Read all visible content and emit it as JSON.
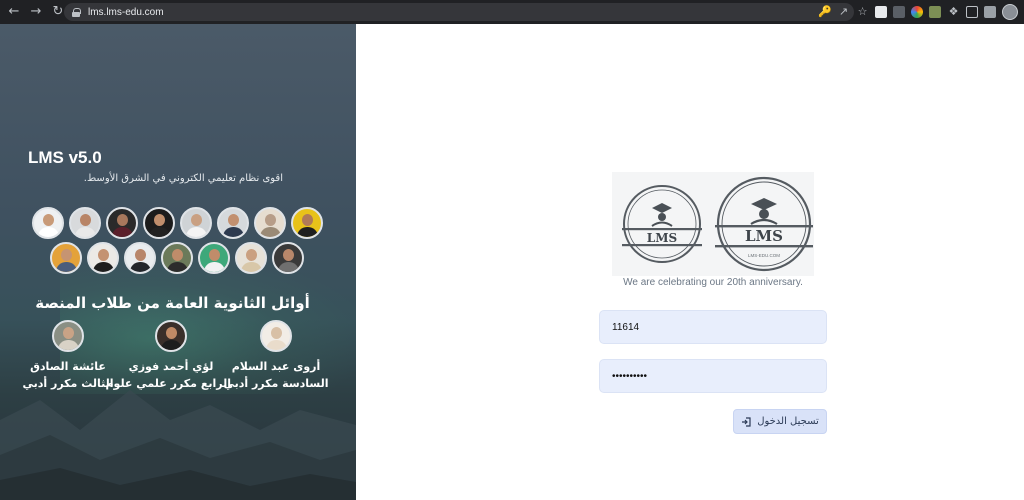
{
  "browser": {
    "url": "lms.lms-edu.com",
    "back_icon": "arrow-left-icon",
    "forward_icon": "arrow-right-icon",
    "reload_icon": "reload-icon"
  },
  "sidebar": {
    "brand_title": "LMS v5.0",
    "brand_subtitle": "اقوى نظام تعليمي الكتروني في الشرق الأوسط.",
    "achievers_title": "أوائل الثانوية العامة من طلاب المنصة",
    "achievers": [
      {
        "name": "عائشة الصادق",
        "rank": "الثالث مكرر أدبي"
      },
      {
        "name": "لؤي أحمد فوزي",
        "rank": "الرابع مكرر علمي علوم"
      },
      {
        "name": "أروى عبد السلام",
        "rank": "السادسة مكرر أدبي"
      }
    ]
  },
  "login": {
    "logo_text": "LMS",
    "logo_arc_text": "LEARNING MANAGEMENT SYSTEM",
    "logo_domain": "LMS-EDU.COM",
    "tagline": "We are celebrating our 20th anniversary.",
    "username_value": "11614",
    "password_value": "••••••••••",
    "login_button": "تسجيل الدخول",
    "login_icon": "sign-in-icon"
  },
  "colors": {
    "panel_dark": "#3f5160",
    "input_bg": "#e8eefc",
    "button_bg": "#d9e2f8"
  }
}
